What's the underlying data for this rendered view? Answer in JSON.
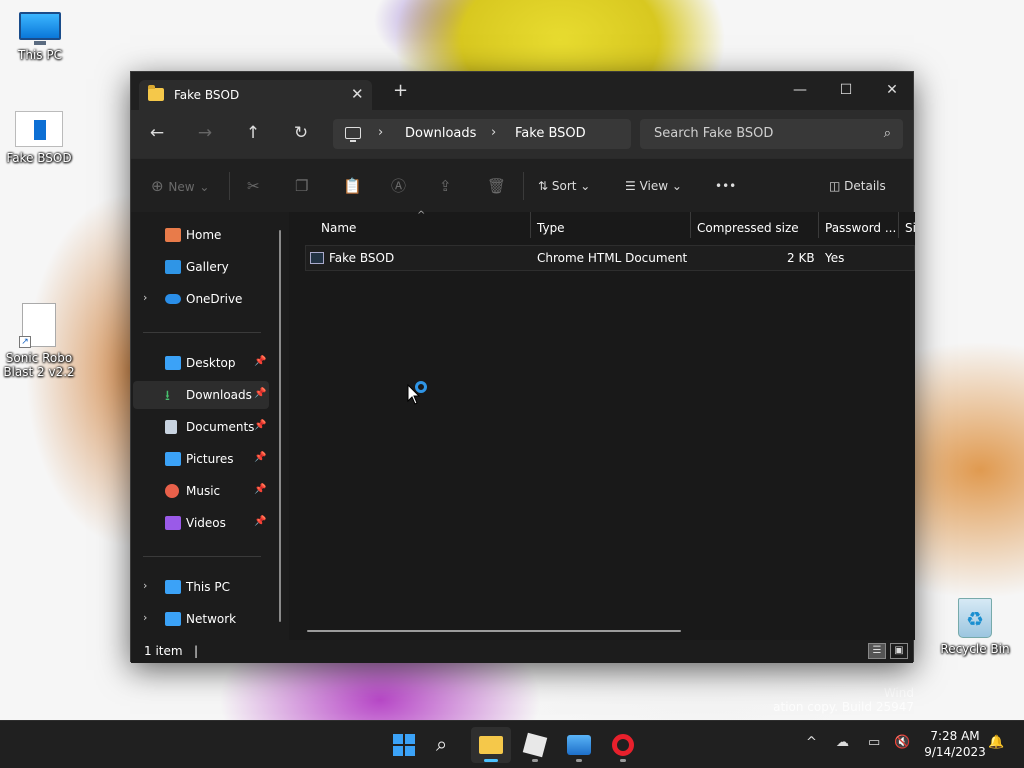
{
  "desktop": {
    "icons": [
      {
        "label": "This PC"
      },
      {
        "label": "Fake BSOD"
      },
      {
        "label": "Sonic Robo Blast 2 v2.2"
      },
      {
        "label": "Recycle Bin"
      }
    ],
    "watermark": {
      "line1": "Wind",
      "line2": "ation copy. Build 25947"
    }
  },
  "window": {
    "tab_title": "Fake BSOD",
    "new_tab_label": "+",
    "controls": {
      "minimize": "—",
      "maximize": "☐",
      "close": "✕"
    }
  },
  "nav": {
    "back": "←",
    "forward": "→",
    "up": "↑",
    "refresh": "↻",
    "breadcrumb": [
      "Downloads",
      "Fake BSOD"
    ],
    "search_placeholder": "Search Fake BSOD"
  },
  "toolbar": {
    "new_label": "New",
    "sort_label": "Sort",
    "view_label": "View",
    "more_label": "•••",
    "details_label": "Details"
  },
  "sidebar": {
    "items": [
      {
        "label": "Home",
        "icon": "home-icon",
        "color": "#e87b4a"
      },
      {
        "label": "Gallery",
        "icon": "gallery-icon",
        "color": "#2f95e6"
      },
      {
        "label": "OneDrive",
        "icon": "cloud-icon",
        "color": "#2a8ee8"
      },
      {
        "label": "Desktop",
        "icon": "desktop-icon",
        "color": "#3ba2f7"
      },
      {
        "label": "Downloads",
        "icon": "download-icon",
        "color": "#47c16e"
      },
      {
        "label": "Documents",
        "icon": "document-icon",
        "color": "#c8d3e0"
      },
      {
        "label": "Pictures",
        "icon": "pictures-icon",
        "color": "#3ba2f7"
      },
      {
        "label": "Music",
        "icon": "music-icon",
        "color": "#e8604a"
      },
      {
        "label": "Videos",
        "icon": "videos-icon",
        "color": "#9a5ae8"
      },
      {
        "label": "This PC",
        "icon": "computer-icon",
        "color": "#3ba2f7"
      },
      {
        "label": "Network",
        "icon": "network-icon",
        "color": "#3ba2f7"
      }
    ]
  },
  "table": {
    "columns": [
      "Name",
      "Type",
      "Compressed size",
      "Password ...",
      "Si"
    ],
    "rows": [
      {
        "name": "Fake BSOD",
        "type": "Chrome HTML Document",
        "compressed": "2 KB",
        "password": "Yes"
      }
    ]
  },
  "status": {
    "item_count": "1 item",
    "cursor": "|"
  },
  "taskbar": {
    "clock_time": "7:28 AM",
    "clock_date": "9/14/2023",
    "tray_chevron": "^"
  },
  "colors": {
    "accent": "#4cc2ff",
    "selection": "#2d2d2d",
    "window_bg": "#191919"
  }
}
